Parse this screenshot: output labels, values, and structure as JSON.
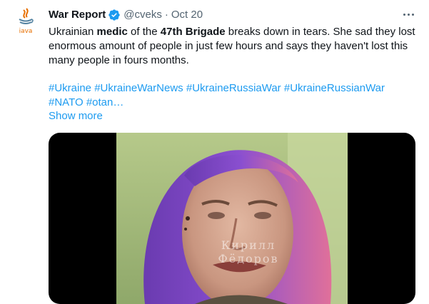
{
  "author": {
    "name": "War Report",
    "handle": "@cveks",
    "separator": "·",
    "time": "Oct 20",
    "avatar_icon": "java-logo-icon",
    "avatar_text": "java"
  },
  "tweet": {
    "text_part1": "Ukrainian ",
    "text_bold1": "medic",
    "text_part2": " of the ",
    "text_bold2": "47th Brigade",
    "text_part3": " breaks down in tears. She sad they lost enormous amount of people in just few hours and says they haven't lost this many people in fours months.",
    "hashtags": [
      "#Ukraine",
      "#UkraineWarNews",
      "#UkraineRussiaWar",
      "#UkraineRussianWar",
      "#NATO",
      "#otan…"
    ],
    "show_more": "Show more"
  },
  "media": {
    "watermark_line1": "Кирилл",
    "watermark_line2": "Фёдоров"
  },
  "colors": {
    "accent": "#1d9bf0",
    "secondary_text": "#536471",
    "hair_purple": "#8a4fd0",
    "hair_pink": "#e0709a"
  }
}
